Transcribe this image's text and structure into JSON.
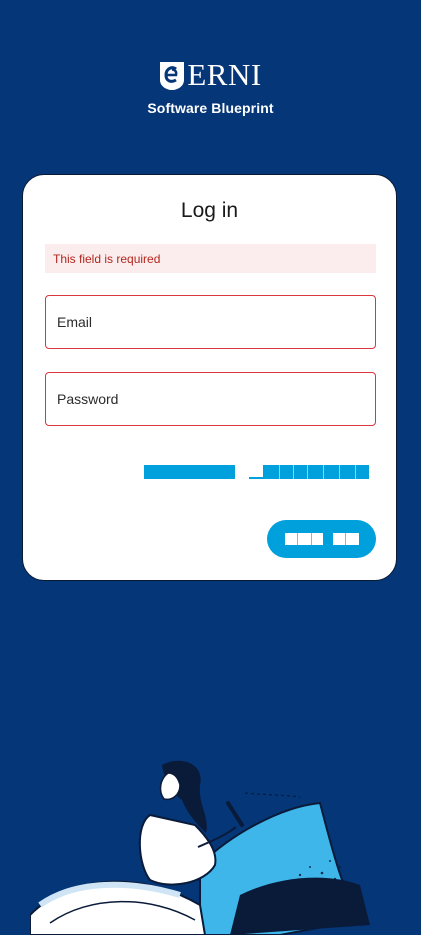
{
  "brand": {
    "name": "ERNI",
    "tagline": "Software Blueprint",
    "logo_icon": "erni-e-badge-icon"
  },
  "login": {
    "title": "Log in",
    "error_message": "This field is required",
    "email_label": "Email",
    "password_label": "Password"
  },
  "colors": {
    "background": "#053677",
    "accent": "#00a0dc",
    "error": "#d9363e",
    "error_bg": "#fbeded"
  },
  "illustration": "woman-reading-book-illustration"
}
